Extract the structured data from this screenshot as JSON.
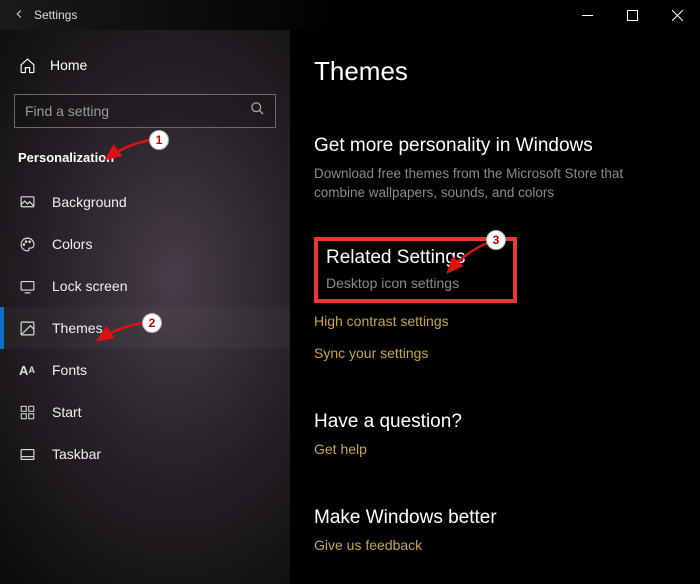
{
  "titlebar": {
    "title": "Settings"
  },
  "sidebar": {
    "home": "Home",
    "search_placeholder": "Find a setting",
    "category": "Personalization",
    "items": [
      {
        "label": "Background"
      },
      {
        "label": "Colors"
      },
      {
        "label": "Lock screen"
      },
      {
        "label": "Themes"
      },
      {
        "label": "Fonts"
      },
      {
        "label": "Start"
      },
      {
        "label": "Taskbar"
      }
    ]
  },
  "content": {
    "page_title": "Themes",
    "more_personality": {
      "heading": "Get more personality in Windows",
      "sub": "Download free themes from the Microsoft Store that combine wallpapers, sounds, and colors"
    },
    "related": {
      "heading": "Related Settings",
      "desktop_icon": "Desktop icon settings",
      "high_contrast": "High contrast settings",
      "sync": "Sync your settings"
    },
    "question": {
      "heading": "Have a question?",
      "link": "Get help"
    },
    "better": {
      "heading": "Make Windows better",
      "link": "Give us feedback"
    }
  },
  "annotations": {
    "b1": "1",
    "b2": "2",
    "b3": "3"
  }
}
